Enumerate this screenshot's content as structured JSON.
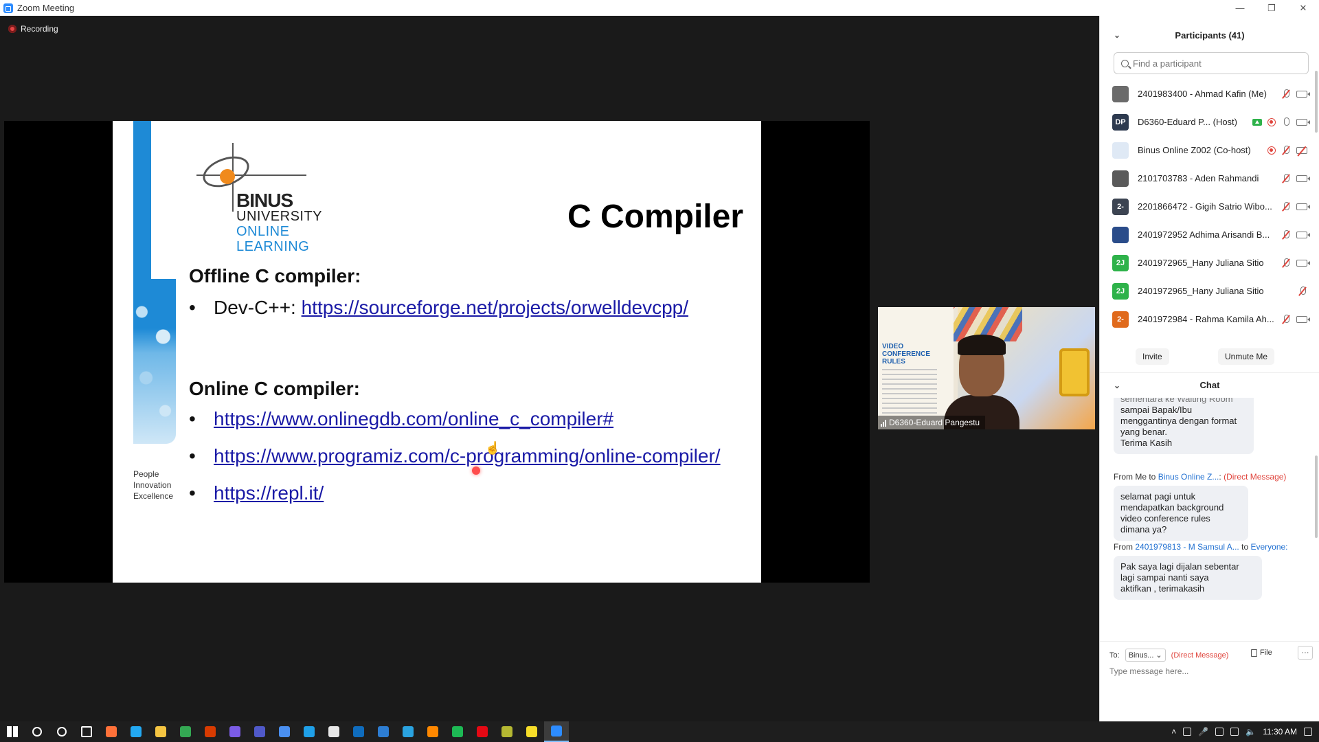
{
  "window": {
    "title": "Zoom Meeting"
  },
  "meeting": {
    "recording_label": "Recording"
  },
  "slide": {
    "title": "C Compiler",
    "logo": {
      "line1": "BINUS",
      "line2": "UNIVERSITY",
      "line3": "ONLINE",
      "line4": "LEARNING"
    },
    "tagline": [
      "People",
      "Innovation",
      "Excellence"
    ],
    "offline_heading": "Offline C compiler:",
    "offline_items": [
      {
        "prefix": "Dev-C++: ",
        "link": "https://sourceforge.net/projects/orwelldevcpp/"
      }
    ],
    "online_heading": "Online C compiler:",
    "online_items": [
      {
        "link": "https://www.onlinegdb.com/online_c_compiler#"
      },
      {
        "link": "https://www.programiz.com/c-programming/online-compiler/"
      },
      {
        "link": "https://repl.it/"
      }
    ],
    "bullet": "•"
  },
  "speaker": {
    "name": "D6360-Eduard Pangestu",
    "card_title": [
      "VIDEO",
      "CONFERENCE",
      "RULES"
    ]
  },
  "participants": {
    "header": "Participants (41)",
    "search_placeholder": "Find a participant",
    "list": [
      {
        "initials": "",
        "avatar_color": "#6b6b6b",
        "name": "2401983400 - Ahmad Kafin (Me)",
        "mic": "off",
        "cam": "on",
        "extras": []
      },
      {
        "initials": "DP",
        "avatar_color": "#2d3a4f",
        "name": "D6360-Eduard P...  (Host)",
        "mic": "on",
        "cam": "on",
        "extras": [
          "share",
          "rec"
        ]
      },
      {
        "initials": "",
        "avatar_color": "#dfe9f5",
        "name": "Binus Online Z002 (Co-host)",
        "mic": "off",
        "cam": "off",
        "extras": [
          "rec"
        ]
      },
      {
        "initials": "",
        "avatar_color": "#5a5a5a",
        "name": "2101703783 - Aden Rahmandi",
        "mic": "off",
        "cam": "on",
        "extras": []
      },
      {
        "initials": "2-",
        "avatar_color": "#3c4452",
        "name": "2201866472 - Gigih Satrio Wibo...",
        "mic": "off",
        "cam": "on",
        "extras": []
      },
      {
        "initials": "",
        "avatar_color": "#2a4c8a",
        "name": "2401972952 Adhima Arisandi B...",
        "mic": "off",
        "cam": "on",
        "extras": []
      },
      {
        "initials": "2J",
        "avatar_color": "#2eb24a",
        "name": "2401972965_Hany Juliana Sitio",
        "mic": "off",
        "cam": "on",
        "extras": []
      },
      {
        "initials": "2J",
        "avatar_color": "#2eb24a",
        "name": "2401972965_Hany Juliana Sitio",
        "mic": "off",
        "cam": "none",
        "extras": []
      },
      {
        "initials": "2-",
        "avatar_color": "#e06a1c",
        "name": "2401972984 - Rahma Kamila Ah...",
        "mic": "off",
        "cam": "on",
        "extras": []
      }
    ],
    "invite_label": "Invite",
    "unmute_label": "Unmute Me"
  },
  "chat": {
    "header": "Chat",
    "msg0_text_lines": [
      "sementara ke Waiting Room",
      "sampai Bapak/Ibu",
      "menggantinya dengan format",
      "yang benar.",
      "Terima Kasih"
    ],
    "msg1_from": {
      "prefix": "From Me to ",
      "to": "Binus Online Z...",
      "sep": ": ",
      "dm": "(Direct Message)"
    },
    "msg1_text_lines": [
      "selamat pagi untuk",
      "mendapatkan background",
      "video conference rules",
      "dimana ya?"
    ],
    "msg2_from": {
      "prefix": "From ",
      "sender": "2401979813 - M Samsul A...",
      "mid": " to ",
      "to": "Everyone:"
    },
    "msg2_text_lines": [
      "Pak saya lagi dijalan sebentar",
      "lagi sampai nanti saya",
      "aktifkan , terimakasih"
    ],
    "to_label": "To:",
    "to_value": "Binus...",
    "to_dm": "(Direct Message)",
    "file_label": "File",
    "more_label": "···",
    "input_placeholder": "Type message here..."
  },
  "taskbar": {
    "clock": "11:30 AM",
    "apps": [
      "windows-start",
      "search",
      "cortana",
      "task-view",
      "firefox",
      "vscode",
      "file-explorer",
      "chrome",
      "office",
      "app-purple",
      "teams",
      "app-blue",
      "edge",
      "store",
      "outlook",
      "mail",
      "telegram",
      "vlc",
      "spotify",
      "netflix",
      "app-green",
      "sticky-notes",
      "zoom"
    ],
    "colors": [
      "#ffffff",
      "#ffffff",
      "#ffffff",
      "#ffffff",
      "#ff7139",
      "#23a9f2",
      "#f5c542",
      "#34a853",
      "#d83b01",
      "#7b5ce6",
      "#5059c9",
      "#4a8ff0",
      "#1fa0e8",
      "#e8e8e8",
      "#0f6cbd",
      "#2d7dd2",
      "#2aa3e0",
      "#ff8800",
      "#1db954",
      "#e50914",
      "#b5b832",
      "#f7dd29",
      "#2d8cff"
    ]
  }
}
